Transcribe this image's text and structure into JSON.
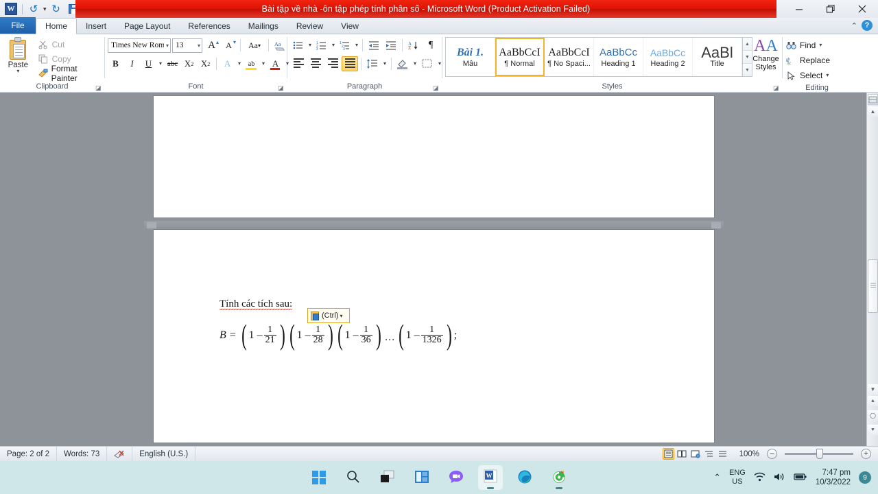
{
  "window": {
    "title": "Bài tập về nhà -ôn tập phép tính phân số  -  Microsoft Word (Product Activation Failed)",
    "minimize_label": "–",
    "restore_label": "❐",
    "close_label": "✕",
    "collapse_ribbon_label": "⌃",
    "help_label": "?",
    "titlebar_color": "#e01405"
  },
  "quick_access": {
    "app_logo": "word-logo",
    "items": [
      {
        "name": "undo-button",
        "glyph": "↺",
        "caret": "▾"
      },
      {
        "name": "redo-button",
        "glyph": "↻"
      },
      {
        "name": "save-button",
        "glyph": "save"
      },
      {
        "name": "customize-qat-button",
        "glyph": "▾"
      }
    ]
  },
  "ribbon": {
    "tabs": [
      {
        "label": "File",
        "active": false,
        "file": true
      },
      {
        "label": "Home",
        "active": true
      },
      {
        "label": "Insert",
        "active": false
      },
      {
        "label": "Page Layout",
        "active": false
      },
      {
        "label": "References",
        "active": false
      },
      {
        "label": "Mailings",
        "active": false
      },
      {
        "label": "Review",
        "active": false
      },
      {
        "label": "View",
        "active": false
      }
    ],
    "groups": {
      "clipboard": {
        "label": "Clipboard",
        "paste_label": "Paste",
        "paste_caret": "▾",
        "items": [
          {
            "label": "Cut",
            "icon": "scissors-icon",
            "glyph": "✂",
            "disabled": true
          },
          {
            "label": "Copy",
            "icon": "copy-icon",
            "glyph": "❐",
            "disabled": true
          },
          {
            "label": "Format Painter",
            "icon": "format-painter-icon",
            "glyph": "🖌",
            "disabled": false
          }
        ]
      },
      "font": {
        "label": "Font",
        "font_name": "Times New Rom",
        "font_size": "13",
        "buttons_row1": [
          {
            "name": "grow-font-button",
            "glyph": "A"
          },
          {
            "name": "shrink-font-button",
            "glyph": "A"
          },
          {
            "name": "change-case-button",
            "glyph": "Aa"
          },
          {
            "name": "clear-formatting-button",
            "glyph": "A"
          }
        ],
        "buttons_row2": [
          {
            "name": "bold-button",
            "glyph": "B"
          },
          {
            "name": "italic-button",
            "glyph": "I"
          },
          {
            "name": "underline-button",
            "glyph": "U"
          },
          {
            "name": "strikethrough-button",
            "glyph": "abc"
          },
          {
            "name": "subscript-button",
            "glyph": "X₂"
          },
          {
            "name": "superscript-button",
            "glyph": "X²"
          },
          {
            "name": "text-effects-button",
            "glyph": "A"
          },
          {
            "name": "text-highlight-button",
            "glyph": "ab"
          },
          {
            "name": "font-color-button",
            "glyph": "A"
          }
        ]
      },
      "paragraph": {
        "label": "Paragraph",
        "buttons_row1": [
          {
            "name": "bullets-button",
            "glyph": "☰"
          },
          {
            "name": "numbering-button",
            "glyph": "☰"
          },
          {
            "name": "multilevel-list-button",
            "glyph": "☰"
          },
          {
            "name": "decrease-indent-button",
            "glyph": "⇤"
          },
          {
            "name": "increase-indent-button",
            "glyph": "⇥"
          },
          {
            "name": "sort-button",
            "glyph": "A↓"
          },
          {
            "name": "show-formatting-marks-button",
            "glyph": "¶"
          }
        ],
        "buttons_row2": [
          {
            "name": "align-left-button",
            "glyph": "≡",
            "active": false
          },
          {
            "name": "align-center-button",
            "glyph": "≡",
            "active": false
          },
          {
            "name": "align-right-button",
            "glyph": "≡",
            "active": false
          },
          {
            "name": "justify-button",
            "glyph": "≡",
            "active": true
          },
          {
            "name": "line-spacing-button",
            "glyph": "↕"
          },
          {
            "name": "shading-button",
            "glyph": "▨"
          },
          {
            "name": "borders-button",
            "glyph": "⊞"
          }
        ]
      },
      "styles": {
        "label": "Styles",
        "items": [
          {
            "preview": "Bài 1.",
            "name": "Mẫu",
            "selected": false
          },
          {
            "preview": "AaBbCcI",
            "name": "¶ Normal",
            "selected": true
          },
          {
            "preview": "AaBbCcI",
            "name": "¶ No Spaci...",
            "selected": false
          },
          {
            "preview": "AaBbCc",
            "name": "Heading 1",
            "selected": false
          },
          {
            "preview": "AaBbCc",
            "name": "Heading 2",
            "selected": false
          },
          {
            "preview": "AaBl",
            "name": "Title",
            "selected": false
          }
        ],
        "change_styles_label": "Change",
        "change_styles_label2": "Styles",
        "change_styles_caret": "▾"
      },
      "editing": {
        "label": "Editing",
        "items": [
          {
            "label": "Find",
            "icon": "binoculars-icon",
            "glyph": "🔍",
            "caret": "▾"
          },
          {
            "label": "Replace",
            "icon": "replace-icon",
            "glyph": "ab",
            "caret": ""
          },
          {
            "label": "Select",
            "icon": "cursor-icon",
            "glyph": "⇱",
            "caret": "▾"
          }
        ]
      }
    }
  },
  "document": {
    "heading_text": "Tính các tích sau:",
    "formula": {
      "lhs": "B =",
      "terms": [
        {
          "lead": "1 –",
          "num": "1",
          "den": "21"
        },
        {
          "lead": "1 –",
          "num": "1",
          "den": "28"
        },
        {
          "lead": "1 –",
          "num": "1",
          "den": "36"
        },
        {
          "lead": "1 –",
          "num": "1",
          "den": "1326"
        }
      ],
      "ellipsis": "…",
      "terminator": ";"
    },
    "paste_options": {
      "label": "(Ctrl)",
      "caret": "▾",
      "icon": "paste-options-icon"
    }
  },
  "status_bar": {
    "page": "Page: 2 of 2",
    "words": "Words: 73",
    "proofing_icon": "proofing-errors-icon",
    "language": "English (U.S.)",
    "zoom_level": "100%",
    "zoom_out": "–",
    "zoom_in": "+",
    "view_buttons": [
      {
        "name": "print-layout-view-button",
        "glyph": "▤",
        "active": true
      },
      {
        "name": "full-screen-reading-view-button",
        "glyph": "▥",
        "active": false
      },
      {
        "name": "web-layout-view-button",
        "glyph": "▦",
        "active": false
      },
      {
        "name": "outline-view-button",
        "glyph": "▤",
        "active": false
      },
      {
        "name": "draft-view-button",
        "glyph": "▤",
        "active": false
      }
    ]
  },
  "scrollbar": {
    "split_handle": "split-handle",
    "up_arrow": "▲",
    "down_arrow": "▼",
    "prev_page": "⯅",
    "select_object": "◯",
    "next_page": "⯆"
  },
  "taskbar": {
    "items": [
      {
        "name": "start-button",
        "icon": "windows-icon",
        "active": false
      },
      {
        "name": "search-button",
        "icon": "search-icon",
        "active": false
      },
      {
        "name": "task-view-button",
        "icon": "task-view-icon",
        "active": false
      },
      {
        "name": "widgets-button",
        "icon": "widgets-icon",
        "active": false
      },
      {
        "name": "chat-button",
        "icon": "chat-icon",
        "active": false
      },
      {
        "name": "word-taskbar-button",
        "icon": "word-icon",
        "active": true
      },
      {
        "name": "edge-taskbar-button",
        "icon": "edge-icon",
        "active": false
      },
      {
        "name": "green-app-taskbar-button",
        "icon": "green-app-icon",
        "active": false
      }
    ],
    "tray": {
      "chevron": "⌃",
      "language_line1": "ENG",
      "language_line2": "US",
      "wifi_icon": "wifi-icon",
      "volume_icon": "volume-icon",
      "battery_icon": "battery-icon",
      "time": "7:47 pm",
      "date": "10/3/2022",
      "badge": "9"
    }
  }
}
